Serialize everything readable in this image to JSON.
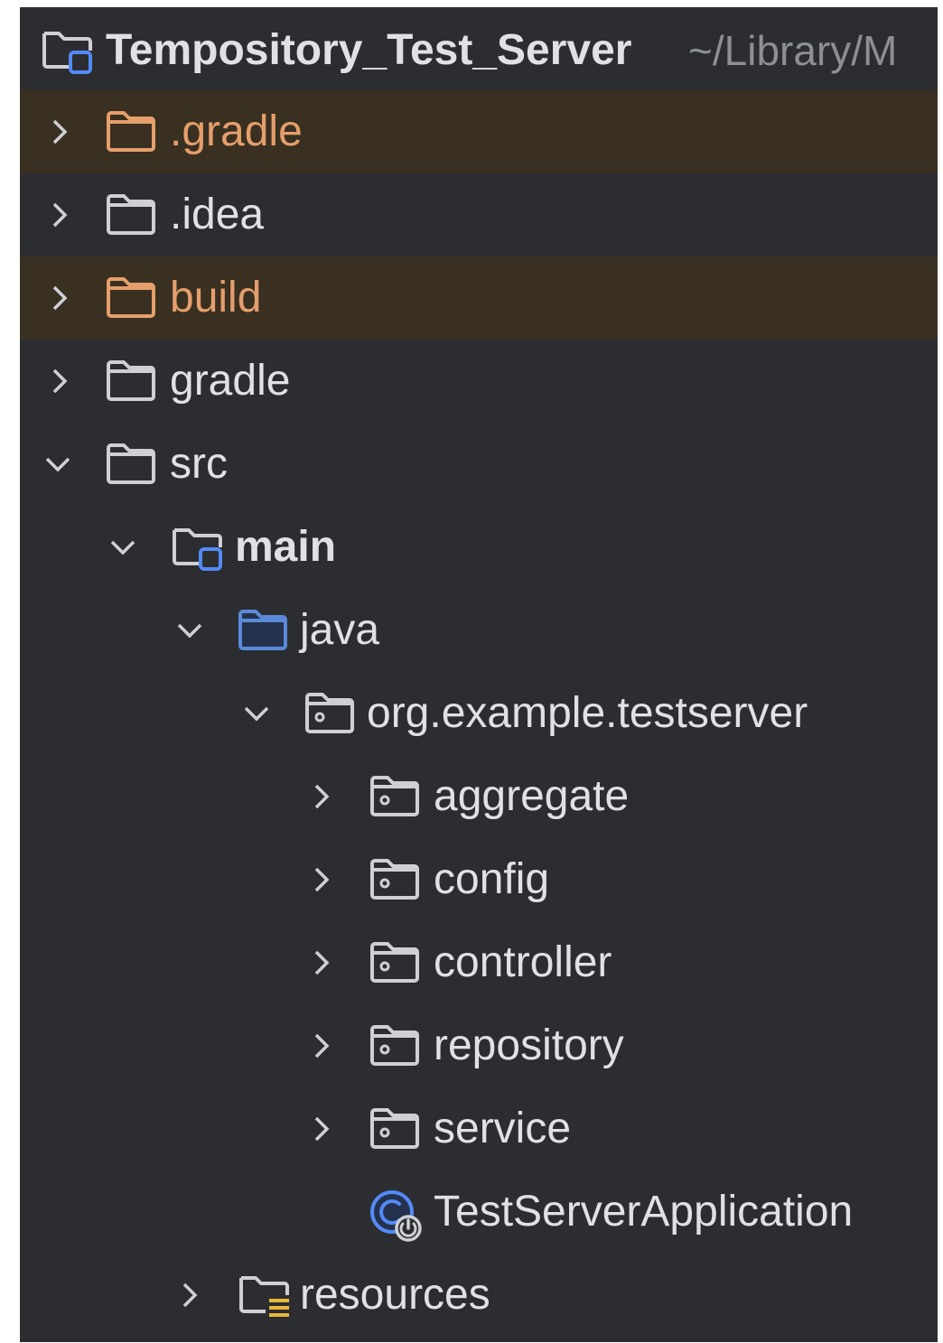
{
  "project": {
    "name": "Tempository_Test_Server",
    "path": "~/Library/M"
  },
  "colors": {
    "panel_bg": "#2b2d30",
    "excluded_row_bg": "#3a3021",
    "excluded_text": "#e59f6c",
    "source_folder": "#5a8ad8",
    "default_text": "#dfe1e5"
  },
  "tree": [
    {
      "label": ".gradle",
      "expanded": false,
      "icon": "folder-excluded-icon",
      "state": "excluded"
    },
    {
      "label": ".idea",
      "expanded": false,
      "icon": "folder-icon",
      "state": "normal"
    },
    {
      "label": "build",
      "expanded": false,
      "icon": "folder-excluded-icon",
      "state": "excluded"
    },
    {
      "label": "gradle",
      "expanded": false,
      "icon": "folder-icon",
      "state": "normal"
    },
    {
      "label": "src",
      "expanded": true,
      "icon": "folder-icon",
      "state": "normal"
    },
    {
      "label": "main",
      "expanded": true,
      "icon": "module-folder-icon",
      "state": "module"
    },
    {
      "label": "java",
      "expanded": true,
      "icon": "source-root-folder-icon",
      "state": "source"
    },
    {
      "label": "org.example.testserver",
      "expanded": true,
      "icon": "package-icon",
      "state": "normal"
    },
    {
      "label": "aggregate",
      "expanded": false,
      "icon": "package-icon",
      "state": "normal"
    },
    {
      "label": "config",
      "expanded": false,
      "icon": "package-icon",
      "state": "normal"
    },
    {
      "label": "controller",
      "expanded": false,
      "icon": "package-icon",
      "state": "normal"
    },
    {
      "label": "repository",
      "expanded": false,
      "icon": "package-icon",
      "state": "normal"
    },
    {
      "label": "service",
      "expanded": false,
      "icon": "package-icon",
      "state": "normal"
    },
    {
      "label": "TestServerApplication",
      "expanded": null,
      "icon": "spring-boot-class-icon",
      "state": "normal"
    },
    {
      "label": "resources",
      "expanded": false,
      "icon": "resources-folder-icon",
      "state": "normal"
    }
  ]
}
